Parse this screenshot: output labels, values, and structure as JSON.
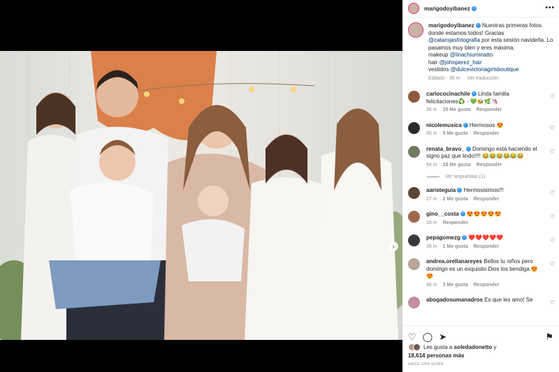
{
  "post": {
    "author": "marigodoyibanez",
    "verified": true,
    "more_label": "•••"
  },
  "caption": {
    "author": "marigodoyibanez",
    "text_1": "Nuestras primeras fotos donde estamos todos! Gracias",
    "mention_1": "@catarojasfotografia",
    "text_2": "por esta sesión navideña. Lo pasamos muy bien y eres máxima.",
    "line_makeup": "makeup",
    "mention_makeup": "@linachiuminatto",
    "line_hair": "hair",
    "mention_hair": "@johnperez_hair",
    "line_vestidos": "vestidos",
    "mention_vestidos": "@dulcevictoriagirlsboutique",
    "edited": "Editado · 36 m",
    "translate": "Ver traducción"
  },
  "comments": [
    {
      "user": "carlococinachile",
      "verified": true,
      "text": "Linda familia felicitaciones♻️ · 💚🐝🌿🦄",
      "time": "36 m",
      "likes": "15 Me gusta",
      "reply": "Responder",
      "color": "#8a5a3c"
    },
    {
      "user": "nicolemusica",
      "verified": true,
      "text": "Hermosos 😍",
      "time": "30 m",
      "likes": "5 Me gusta",
      "reply": "Responder",
      "color": "#2b2b2b"
    },
    {
      "user": "renata_bravo_",
      "verified": true,
      "text": "Domingo está haciendo el signo paz que lindo!!!! 😂😂😂😂😂😂",
      "time": "54 m",
      "likes": "18 Me gusta",
      "reply": "Responder",
      "color": "#6f7b5f"
    },
    {
      "user": "aaristeguia",
      "verified": true,
      "text": "Hermosisimos!!!",
      "time": "27 m",
      "likes": "2 Me gusta",
      "reply": "Responder",
      "color": "#5b4638"
    },
    {
      "user": "gino__costa",
      "verified": true,
      "text": "😍😍😍😍😍",
      "time": "18 m",
      "likes": "",
      "reply": "Responder",
      "color": "#a06a4a"
    },
    {
      "user": "pepagomezg",
      "verified": true,
      "text": "❤️❤️❤️❤️❤️",
      "time": "39 m",
      "likes": "1 Me gusta",
      "reply": "Responder",
      "color": "#3a3a3a"
    },
    {
      "user": "andrea.orellanareyes",
      "verified": false,
      "text": "Bellos tu niños pero domingo es un exquisito Dios los bendiga 😍😍",
      "time": "46 m",
      "likes": "3 Me gusta",
      "reply": "Responder",
      "color": "#b9a59a"
    },
    {
      "user": "abogadosumanadros",
      "verified": false,
      "text": "Es que les amo! Se",
      "time": "",
      "likes": "",
      "reply": "",
      "color": "#c48fa0"
    }
  ],
  "view_replies": "Ver respuestas (1)",
  "actions": {
    "like_icon": "heart-icon",
    "comment_icon": "comment-icon",
    "share_icon": "share-icon",
    "save_icon": "bookmark-icon"
  },
  "likes": {
    "prefix": "Les gusta a",
    "user": "soledadonetto",
    "suffix": "y",
    "others": "18,614 personas más"
  },
  "posted_ago": "HACE UNA HORA",
  "carousel": {
    "total": 8,
    "active": 1
  }
}
